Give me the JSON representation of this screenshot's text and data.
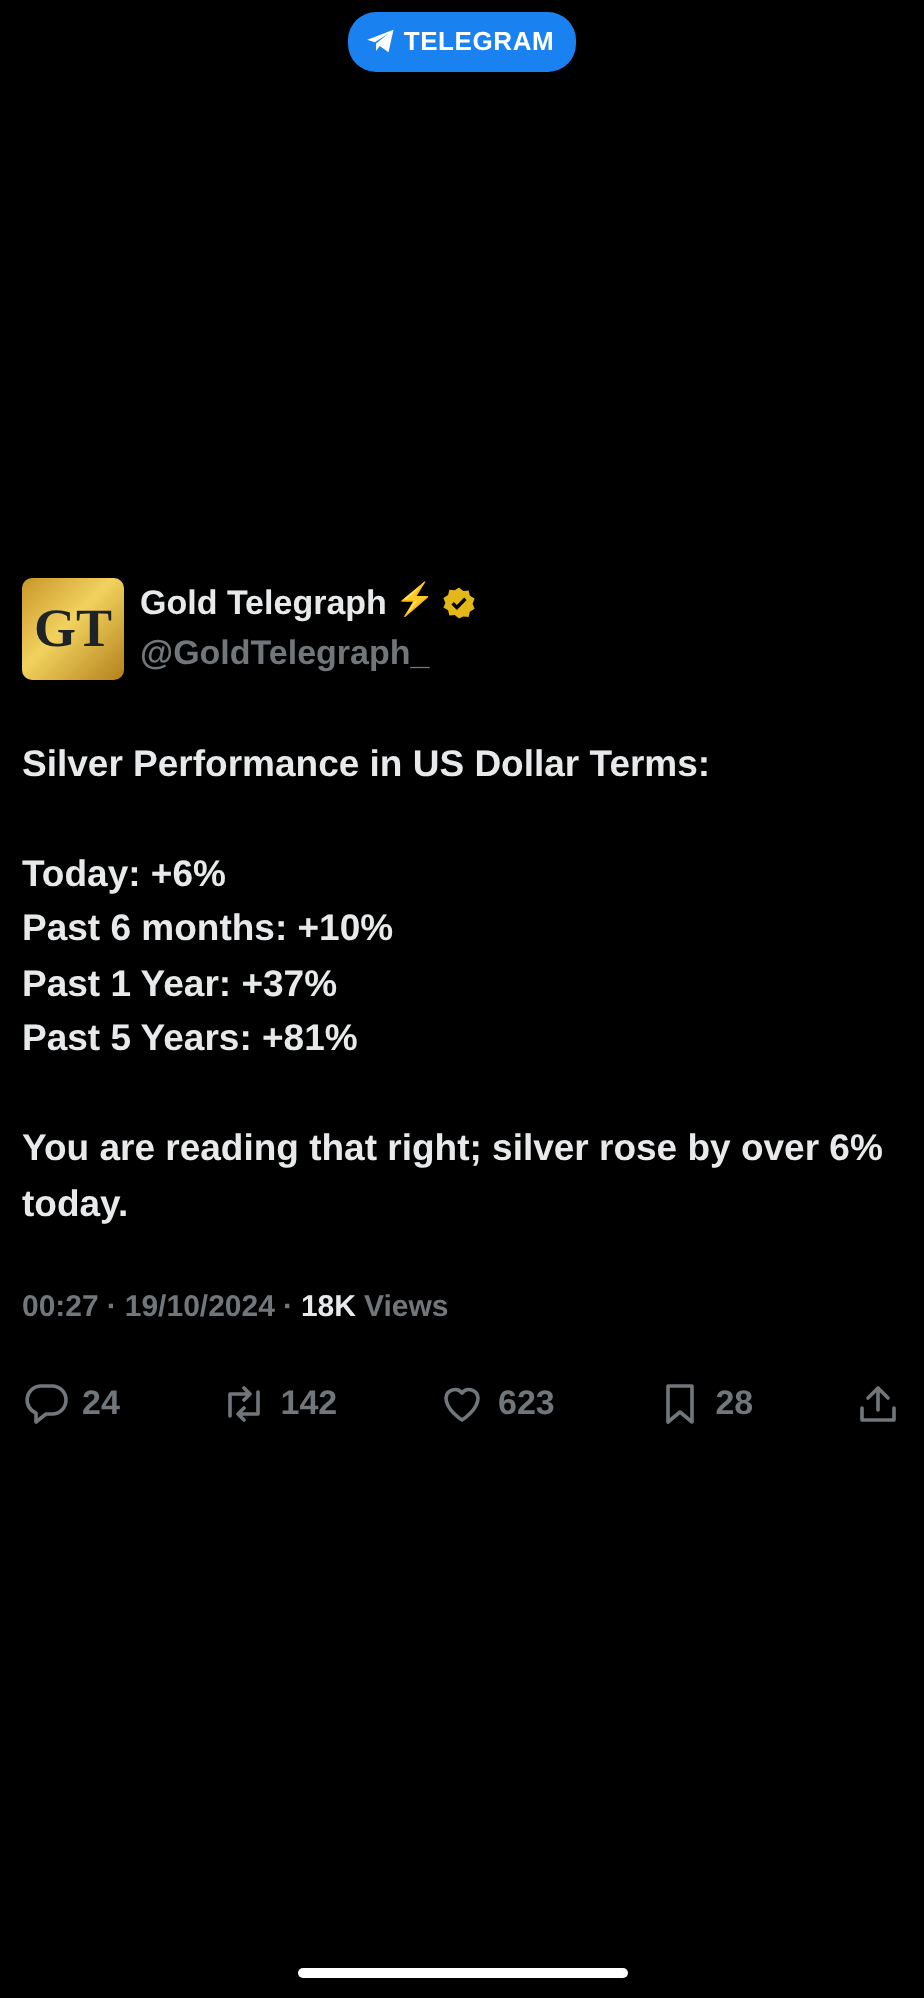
{
  "top_badge": {
    "label": "TELEGRAM"
  },
  "author": {
    "logo": "GT",
    "name": "Gold Telegraph",
    "emoji": "⚡",
    "verified": true,
    "handle": "@GoldTelegraph_"
  },
  "body": [
    [
      "Silver Performance in US Dollar Terms:"
    ],
    [
      "Today: +6%",
      "Past 6 months: +10%",
      "Past 1 Year: +37%",
      "Past 5 Years: +81%"
    ],
    [
      "You are reading that right; silver rose by over 6% today."
    ]
  ],
  "meta": {
    "separator": "·",
    "time": "00:27",
    "date": "19/10/2024",
    "views_count": "18K",
    "views_label": "Views"
  },
  "actions": [
    {
      "kind": "reply",
      "count": "24"
    },
    {
      "kind": "repost",
      "count": "142"
    },
    {
      "kind": "like",
      "count": "623"
    },
    {
      "kind": "bookmark",
      "count": "28"
    },
    {
      "kind": "share"
    }
  ]
}
